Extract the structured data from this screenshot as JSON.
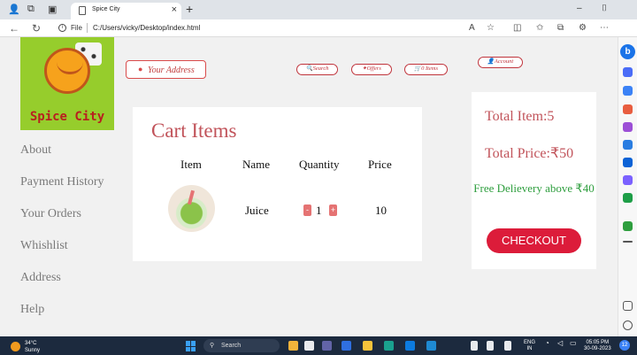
{
  "browser": {
    "tab_title": "Spice City",
    "tab_close": "×",
    "new_tab": "+",
    "window_minimize": "–",
    "window_maximize": "⌷",
    "address_prefix": "File",
    "url": "C:/Users/vicky/Desktop/index.html"
  },
  "brand": {
    "name": "Spice City"
  },
  "header": {
    "address_label": "Your Address",
    "search_label": "Search",
    "offers_label": "Offers",
    "items_label": "0 Items",
    "account_label": "Account"
  },
  "sidebar": {
    "items": [
      {
        "label": "About"
      },
      {
        "label": "Payment History"
      },
      {
        "label": "Your Orders"
      },
      {
        "label": "Whishlist"
      },
      {
        "label": "Address"
      },
      {
        "label": "Help"
      }
    ]
  },
  "cart": {
    "title": "Cart Items",
    "columns": [
      "Item",
      "Name",
      "Quantity",
      "Price"
    ],
    "rows": [
      {
        "name": "Juice",
        "quantity": "1",
        "price": "10"
      }
    ],
    "minus": "-",
    "plus": "+"
  },
  "summary": {
    "total_items": "Total Item:5",
    "total_price": "Total Price:₹50",
    "free_delivery": "Free Delievery above ₹40",
    "checkout_label": "CHECKOUT"
  },
  "taskbar": {
    "temperature": "34°C",
    "condition": "Sunny",
    "search_label": "Search",
    "language": "ENG",
    "region": "IN",
    "time": "05:05 PM",
    "date": "30-09-2023",
    "notification_count": "12"
  },
  "colors": {
    "accent": "#c1535a",
    "checkout": "#dc1c3a",
    "free_delivery": "#2e9e3e",
    "logo_bg": "#96cd2c"
  }
}
